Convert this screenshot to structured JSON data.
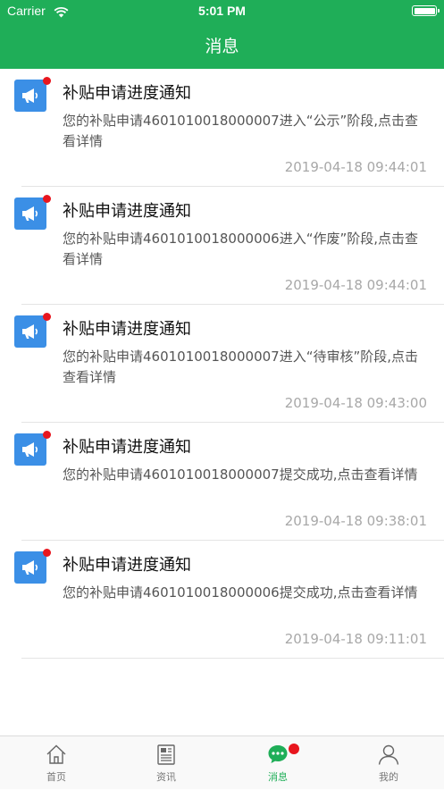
{
  "status_bar": {
    "carrier": "Carrier",
    "time": "5:01 PM"
  },
  "header": {
    "title": "消息"
  },
  "messages": [
    {
      "title": "补贴申请进度通知",
      "body": "您的补贴申请4601010018000007进入“公示”阶段,点击查看详情",
      "time": "2019-04-18 09:44:01",
      "unread": true
    },
    {
      "title": "补贴申请进度通知",
      "body": "您的补贴申请4601010018000006进入“作废”阶段,点击查看详情",
      "time": "2019-04-18 09:44:01",
      "unread": true
    },
    {
      "title": "补贴申请进度通知",
      "body": "您的补贴申请4601010018000007进入“待审核”阶段,点击查看详情",
      "time": "2019-04-18 09:43:00",
      "unread": true
    },
    {
      "title": "补贴申请进度通知",
      "body": "您的补贴申请4601010018000007提交成功,点击查看详情",
      "time": "2019-04-18 09:38:01",
      "unread": true
    },
    {
      "title": "补贴申请进度通知",
      "body": "您的补贴申请4601010018000006提交成功,点击查看详情",
      "time": "2019-04-18 09:11:01",
      "unread": true
    }
  ],
  "tabbar": {
    "active_index": 2,
    "tabs": [
      {
        "label": "首页",
        "icon": "home-icon"
      },
      {
        "label": "资讯",
        "icon": "news-icon"
      },
      {
        "label": "消息",
        "icon": "message-icon",
        "badge": true
      },
      {
        "label": "我的",
        "icon": "profile-icon"
      }
    ]
  },
  "colors": {
    "brand_green": "#1fae58",
    "icon_blue": "#3b8fe6",
    "badge_red": "#e8161e",
    "time_gray": "#a8a8a8"
  }
}
